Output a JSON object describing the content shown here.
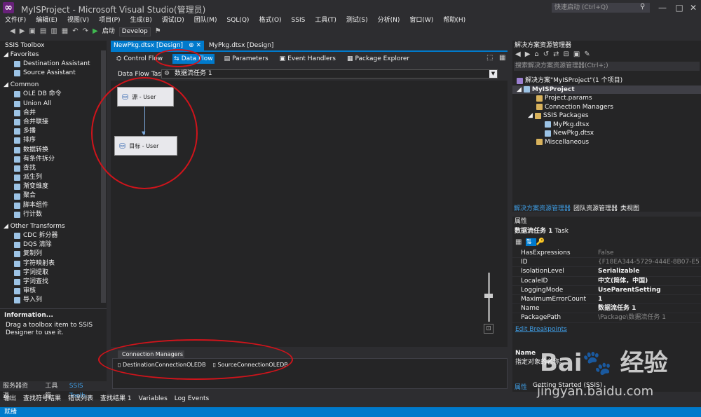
{
  "app": {
    "title": "MyISProject - Microsoft Visual Studio(管理员)",
    "quick_launch": "快速启动 (Ctrl+Q)"
  },
  "menu": [
    "文件(F)",
    "编辑(E)",
    "视图(V)",
    "项目(P)",
    "生成(B)",
    "调试(D)",
    "团队(M)",
    "SQL(Q)",
    "格式(O)",
    "SSIS",
    "工具(T)",
    "测试(S)",
    "分析(N)",
    "窗口(W)",
    "帮助(H)"
  ],
  "toolbar": {
    "start_label": "启动",
    "config_label": "Develop"
  },
  "toolbox": {
    "title": "SSIS Toolbox",
    "favorites_label": "Favorites",
    "favorites": [
      "Destination Assistant",
      "Source Assistant"
    ],
    "common_label": "Common",
    "common": [
      "OLE DB 命令",
      "Union All",
      "合并",
      "合并联接",
      "多播",
      "排序",
      "数据转换",
      "有条件拆分",
      "查找",
      "派生列",
      "渐变维度",
      "聚合",
      "脚本组件",
      "行计数"
    ],
    "other_label": "Other Transforms",
    "other": [
      "CDC 拆分器",
      "DQS 清除",
      "复制列",
      "字符映射表",
      "字词提取",
      "字词查找",
      "审核",
      "导入列"
    ],
    "info_title": "Information...",
    "info_text": "Drag a toolbox item to SSIS Designer to use it."
  },
  "left_tabs": [
    "服务器资源...",
    "工具箱",
    "SSIS Toolb..."
  ],
  "doc_tabs": [
    {
      "label": "NewPkg.dtsx [Design]",
      "active": true
    },
    {
      "label": "MyPkg.dtsx [Design]",
      "active": false
    }
  ],
  "design_tabs": [
    "Control Flow",
    "Data Flow",
    "Parameters",
    "Event Handlers",
    "Package Explorer"
  ],
  "dataflow": {
    "task_label": "Data Flow Task:",
    "task_value": "数据流任务 1"
  },
  "nodes": {
    "source": "源 - User",
    "dest": "目标 - User"
  },
  "conn_mgr": {
    "title": "Connection Managers",
    "items": [
      "DestinationConnectionOLEDB",
      "SourceConnectionOLEDB"
    ]
  },
  "bottom_tabs": [
    "输出",
    "查找符号结果",
    "错误列表",
    "查找结果 1",
    "Variables",
    "Log Events"
  ],
  "status": {
    "text": "就绪"
  },
  "solution": {
    "title": "解决方案资源管理器",
    "search_placeholder": "搜索解决方案资源管理器(Ctrl+;)",
    "root": "解决方案\"MyISProject\"(1 个项目)",
    "project": "MyISProject",
    "params": "Project.params",
    "conn": "Connection Managers",
    "pkgs": "SSIS Packages",
    "pkg1": "MyPkg.dtsx",
    "pkg2": "NewPkg.dtsx",
    "misc": "Miscellaneous",
    "tabs": [
      "解决方案资源管理器",
      "团队资源管理器",
      "类视图"
    ]
  },
  "properties": {
    "title": "属性",
    "object": "数据流任务 1",
    "object_type": "Task",
    "rows": [
      {
        "name": "HasExpressions",
        "value": "False"
      },
      {
        "name": "ID",
        "value": "{F18EA344-5729-444E-8B07-E5"
      },
      {
        "name": "IsolationLevel",
        "value": "Serializable"
      },
      {
        "name": "LocaleID",
        "value": "中文(简体，中国)"
      },
      {
        "name": "LoggingMode",
        "value": "UseParentSetting"
      },
      {
        "name": "MaximumErrorCount",
        "value": "1"
      },
      {
        "name": "Name",
        "value": "数据流任务 1"
      },
      {
        "name": "PackagePath",
        "value": "\\Package\\数据流任务 1"
      }
    ],
    "link": "Edit Breakpoints",
    "desc_title": "Name",
    "desc_text": "指定对象的名称。",
    "tabs": [
      "属性",
      "Getting Started (SSIS)"
    ]
  },
  "colors": {
    "accent": "#007acc",
    "annotation": "#d0141b",
    "bg": "#2d2d30"
  }
}
